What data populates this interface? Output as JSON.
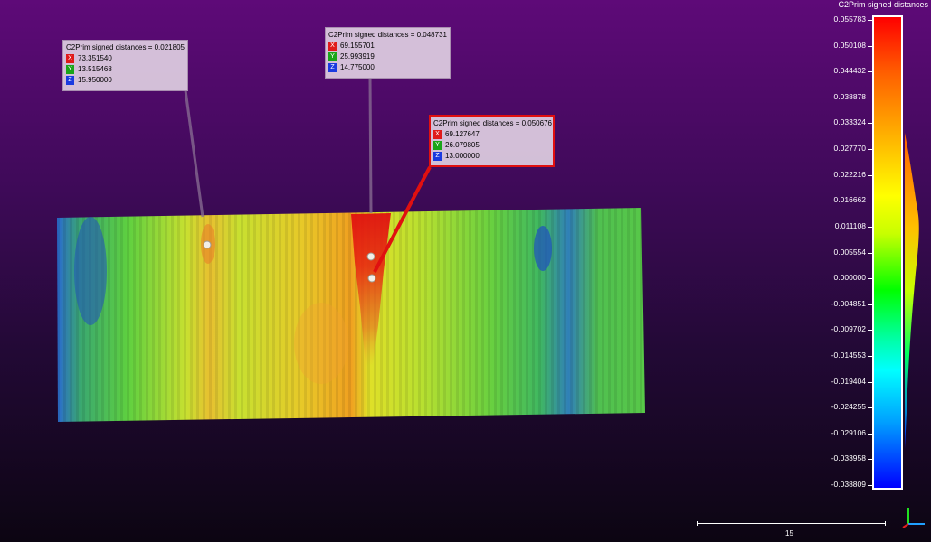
{
  "scale": {
    "title": "C2Prim signed distances",
    "ticks": [
      "0.055783",
      "0.050108",
      "0.044432",
      "0.038878",
      "0.033324",
      "0.027770",
      "0.022216",
      "0.016662",
      "0.011108",
      "0.005554",
      "0.000000",
      "-0.004851",
      "-0.009702",
      "-0.014553",
      "-0.019404",
      "-0.024255",
      "-0.029106",
      "-0.033958",
      "-0.038809"
    ]
  },
  "labels": [
    {
      "title": "C2Prim signed distances = 0.021805",
      "x": "73.351540",
      "y": "13.515468",
      "z": "15.950000"
    },
    {
      "title": "C2Prim signed distances = 0.048731",
      "x": "69.155701",
      "y": "25.993919",
      "z": "14.775000"
    },
    {
      "title": "C2Prim signed distances = 0.050676",
      "x": "69.127647",
      "y": "26.079805",
      "z": "13.000000"
    }
  ],
  "coord_tags": {
    "x": "X",
    "y": "Y",
    "z": "Z"
  },
  "ruler": {
    "value": "15"
  },
  "colors": {
    "selected_border": "#e01010",
    "background_top": "#5e0a78",
    "background_bottom": "#0c0512"
  }
}
